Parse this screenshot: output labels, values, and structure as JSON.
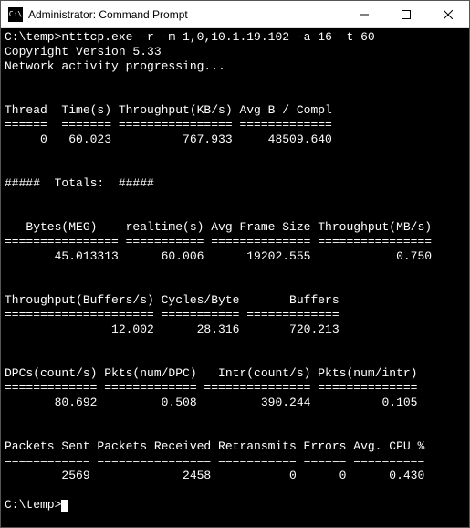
{
  "window": {
    "title": "Administrator: Command Prompt",
    "icon_glyph": "C:\\"
  },
  "terminal": {
    "prompt1": "C:\\temp>",
    "command": "ntttcp.exe -r -m 1,0,10.1.19.102 -a 16 -t 60",
    "copyright": "Copyright Version 5.33",
    "progress": "Network activity progressing...",
    "sect1_headers": "Thread  Time(s) Throughput(KB/s) Avg B / Compl",
    "sect1_sep": "======  ======= ================ =============",
    "sect1_row": "     0   60.023          767.933     48509.640",
    "totals_label": "#####  Totals:  #####",
    "sect2_headers": "   Bytes(MEG)    realtime(s) Avg Frame Size Throughput(MB/s)",
    "sect2_sep": "================ =========== ============== ================",
    "sect2_row": "       45.013313      60.006      19202.555            0.750",
    "sect3_headers": "Throughput(Buffers/s) Cycles/Byte       Buffers",
    "sect3_sep": "===================== =========== =============",
    "sect3_row": "               12.002      28.316       720.213",
    "sect4_headers": "DPCs(count/s) Pkts(num/DPC)   Intr(count/s) Pkts(num/intr)",
    "sect4_sep": "============= ============= =============== ==============",
    "sect4_row": "       80.692         0.508         390.244          0.105",
    "sect5_headers": "Packets Sent Packets Received Retransmits Errors Avg. CPU %",
    "sect5_sep": "============ ================ =========== ====== ==========",
    "sect5_row": "        2569             2458           0      0      0.430",
    "prompt2": "C:\\temp>"
  }
}
